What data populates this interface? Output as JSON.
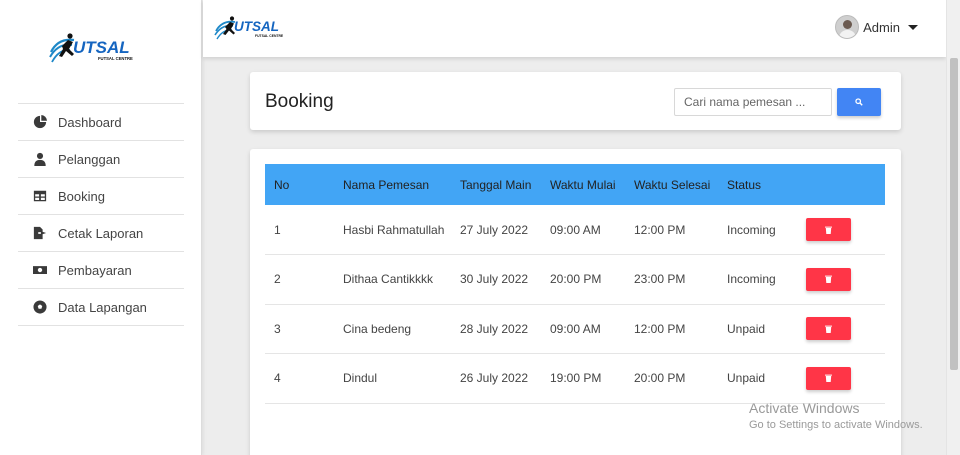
{
  "brand": {
    "logo_text": "UTSAL",
    "logo_subtext": "FUTSAL CENTRE"
  },
  "sidebar": {
    "items": [
      {
        "label": "Dashboard",
        "icon": "pie-chart-icon"
      },
      {
        "label": "Pelanggan",
        "icon": "user-icon"
      },
      {
        "label": "Booking",
        "icon": "table-icon"
      },
      {
        "label": "Cetak Laporan",
        "icon": "file-export-icon"
      },
      {
        "label": "Pembayaran",
        "icon": "money-bill-icon"
      },
      {
        "label": "Data Lapangan",
        "icon": "football-icon"
      }
    ]
  },
  "topbar": {
    "user_label": "Admin"
  },
  "main": {
    "title": "Booking",
    "search": {
      "placeholder": "Cari nama pemesan ...",
      "value": ""
    },
    "table": {
      "columns": [
        "No",
        "Nama Pemesan",
        "Tanggal Main",
        "Waktu Mulai",
        "Waktu Selesai",
        "Status",
        ""
      ],
      "rows": [
        [
          "1",
          "Hasbi Rahmatullah",
          "27 July 2022",
          "09:00 AM",
          "12:00 PM",
          "Incoming"
        ],
        [
          "2",
          "Dithaa Cantikkkk",
          "30 July 2022",
          "20:00 PM",
          "23:00 PM",
          "Incoming"
        ],
        [
          "3",
          "Cina bedeng",
          "28 July 2022",
          "09:00 AM",
          "12:00 PM",
          "Unpaid"
        ],
        [
          "4",
          "Dindul",
          "26 July 2022",
          "19:00 PM",
          "20:00 PM",
          "Unpaid"
        ]
      ]
    }
  },
  "watermark": {
    "line1": "Activate Windows",
    "line2": "Go to Settings to activate Windows."
  },
  "colors": {
    "header_row": "#42a5f5",
    "search_button": "#4285f4",
    "delete_button": "#ff3547"
  }
}
